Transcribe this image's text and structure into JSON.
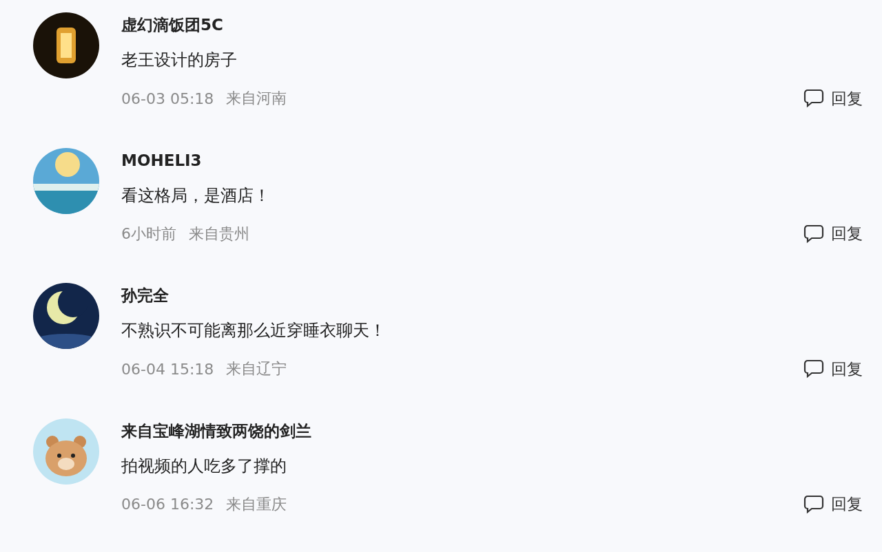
{
  "comments": [
    {
      "kind": "lantern",
      "name": "虚幻滴饭团5C",
      "text": "老王设计的房子",
      "time": "06-03 05:18",
      "location": "来自河南",
      "reply": "回复"
    },
    {
      "kind": "sun",
      "name": "MOHELI3",
      "text": "看这格局，是酒店！",
      "time": "6小时前",
      "location": "来自贵州",
      "reply": "回复"
    },
    {
      "kind": "moon",
      "name": "孙完全",
      "text": "不熟识不可能离那么近穿睡衣聊天！",
      "time": "06-04 15:18",
      "location": "来自辽宁",
      "reply": "回复"
    },
    {
      "kind": "bear",
      "name": "来自宝峰湖情致两饶的剑兰",
      "text": "拍视频的人吃多了撑的",
      "time": "06-06 16:32",
      "location": "来自重庆",
      "reply": "回复"
    }
  ]
}
